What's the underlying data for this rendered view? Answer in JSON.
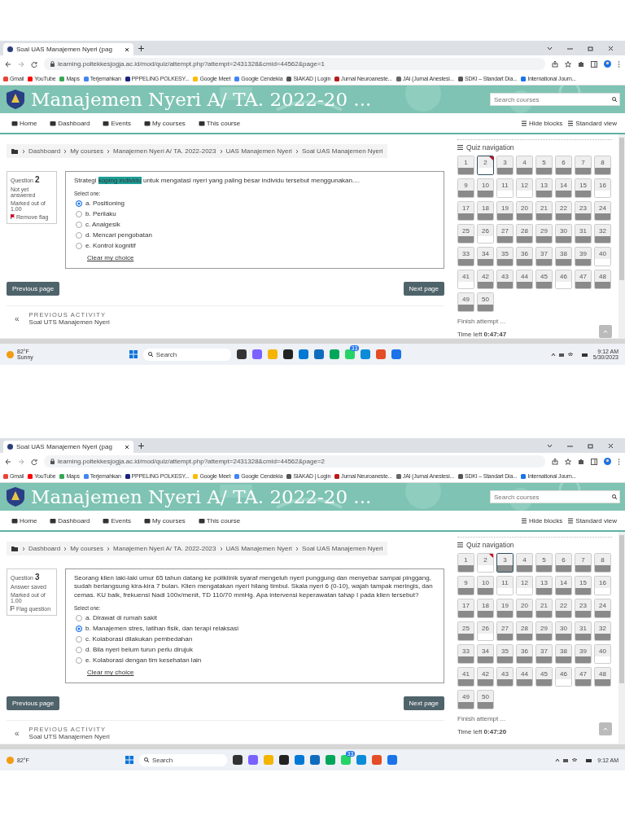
{
  "shots": [
    {
      "tab_title": "Soal UAS Manajemen Nyeri (pag",
      "url": "learning.poltekkesjogja.ac.id/mod/quiz/attempt.php?attempt=2431328&cmid=44562&page=1",
      "bookmarks": [
        "Gmail",
        "YouTube",
        "Maps",
        "Terjemahkan",
        "PPPELING POLKESY...",
        "Google Meet",
        "Google Cendekia",
        "SIAKAD | Login",
        "Jurnal Neuroaneste...",
        "JAI (Jurnal Anestesi...",
        "SDKI – Standart Dia...",
        "International Journ..."
      ],
      "site_title": "Manajemen Nyeri A/ TA. 2022-20 ...",
      "search_placeholder": "Search courses",
      "nav": [
        "Home",
        "Dashboard",
        "Events",
        "My courses",
        "This course"
      ],
      "nav_right": [
        "Hide blocks",
        "Standard view"
      ],
      "breadcrumb": [
        "Dashboard",
        "My courses",
        "Manajemen Nyeri A/ TA. 2022-2023",
        "UAS Manajemen Nyeri",
        "Soal UAS Manajemen Nyeri"
      ],
      "question": {
        "label": "Question",
        "number": "2",
        "status": "Not yet answered",
        "marks": "Marked out of 1.00",
        "flag_action": "Remove flag",
        "flagged": true,
        "text": [
          {
            "text": "Strategi ",
            "highlighted": false
          },
          {
            "text": "koping individu",
            "highlighted": true
          },
          {
            "text": " untuk mengatasi nyeri yang paling besar individu tersebut menggunakan....",
            "highlighted": false
          }
        ],
        "prompt": "Select one:",
        "options": [
          {
            "label": "a. Positioning",
            "selected": true
          },
          {
            "label": "b. Perilaku",
            "selected": false
          },
          {
            "label": "c. Analgesik",
            "selected": false
          },
          {
            "label": "d. Mencari pengobatan",
            "selected": false
          },
          {
            "label": "e. Kontrol kognitif",
            "selected": false
          }
        ],
        "clear": "Clear my choice"
      },
      "buttons": [
        "Previous page",
        "Next page"
      ],
      "previous_activity": {
        "heading": "PREVIOUS ACTIVITY",
        "title": "Soal UTS Manajemen Nyeri",
        "icon": "«"
      },
      "quiz_nav": {
        "title": "Quiz navigation",
        "items": [
          {
            "label": "1",
            "answered": true,
            "current": false,
            "flagged": false
          },
          {
            "label": "2",
            "answered": false,
            "current": true,
            "flagged": true
          },
          {
            "label": "3",
            "answered": true,
            "current": false,
            "flagged": false
          },
          {
            "label": "4",
            "answered": true,
            "current": false,
            "flagged": false
          },
          {
            "label": "5",
            "answered": true,
            "current": false,
            "flagged": false
          },
          {
            "label": "6",
            "answered": true,
            "current": false,
            "flagged": false
          },
          {
            "label": "7",
            "answered": true,
            "current": false,
            "flagged": false
          },
          {
            "label": "8",
            "answered": true,
            "current": false,
            "flagged": false
          },
          {
            "label": "9",
            "answered": true,
            "current": false,
            "flagged": false
          },
          {
            "label": "10",
            "answered": true,
            "current": false,
            "flagged": false
          },
          {
            "label": "11",
            "answered": false,
            "current": false,
            "flagged": false
          },
          {
            "label": "12",
            "answered": false,
            "current": false,
            "flagged": false
          },
          {
            "label": "13",
            "answered": true,
            "current": false,
            "flagged": false
          },
          {
            "label": "14",
            "answered": true,
            "current": false,
            "flagged": false
          },
          {
            "label": "15",
            "answered": true,
            "current": false,
            "flagged": false
          },
          {
            "label": "16",
            "answered": false,
            "current": false,
            "flagged": false
          },
          {
            "label": "17",
            "answered": true,
            "current": false,
            "flagged": false
          },
          {
            "label": "18",
            "answered": true,
            "current": false,
            "flagged": false
          },
          {
            "label": "19",
            "answered": true,
            "current": false,
            "flagged": false
          },
          {
            "label": "20",
            "answered": true,
            "current": false,
            "flagged": false
          },
          {
            "label": "21",
            "answered": true,
            "current": false,
            "flagged": false
          },
          {
            "label": "22",
            "answered": true,
            "current": false,
            "flagged": false
          },
          {
            "label": "23",
            "answered": true,
            "current": false,
            "flagged": false
          },
          {
            "label": "24",
            "answered": true,
            "current": false,
            "flagged": false
          },
          {
            "label": "25",
            "answered": true,
            "current": false,
            "flagged": false
          },
          {
            "label": "26",
            "answered": false,
            "current": false,
            "flagged": false
          },
          {
            "label": "27",
            "answered": true,
            "current": false,
            "flagged": false
          },
          {
            "label": "28",
            "answered": true,
            "current": false,
            "flagged": false
          },
          {
            "label": "29",
            "answered": true,
            "current": false,
            "flagged": false
          },
          {
            "label": "30",
            "answered": true,
            "current": false,
            "flagged": false
          },
          {
            "label": "31",
            "answered": true,
            "current": false,
            "flagged": false
          },
          {
            "label": "32",
            "answered": true,
            "current": false,
            "flagged": false
          },
          {
            "label": "33",
            "answered": true,
            "current": false,
            "flagged": false
          },
          {
            "label": "34",
            "answered": true,
            "current": false,
            "flagged": false
          },
          {
            "label": "35",
            "answered": true,
            "current": false,
            "flagged": false
          },
          {
            "label": "36",
            "answered": true,
            "current": false,
            "flagged": false
          },
          {
            "label": "37",
            "answered": true,
            "current": false,
            "flagged": false
          },
          {
            "label": "38",
            "answered": true,
            "current": false,
            "flagged": false
          },
          {
            "label": "39",
            "answered": true,
            "current": false,
            "flagged": false
          },
          {
            "label": "40",
            "answered": false,
            "current": false,
            "flagged": false
          },
          {
            "label": "41",
            "answered": false,
            "current": false,
            "flagged": false
          },
          {
            "label": "42",
            "answered": true,
            "current": false,
            "flagged": false
          },
          {
            "label": "43",
            "answered": true,
            "current": false,
            "flagged": false
          },
          {
            "label": "44",
            "answered": true,
            "current": false,
            "flagged": false
          },
          {
            "label": "45",
            "answered": true,
            "current": false,
            "flagged": false
          },
          {
            "label": "46",
            "answered": false,
            "current": false,
            "flagged": false
          },
          {
            "label": "47",
            "answered": true,
            "current": false,
            "flagged": false
          },
          {
            "label": "48",
            "answered": true,
            "current": false,
            "flagged": false
          },
          {
            "label": "49",
            "answered": true,
            "current": false,
            "flagged": false
          },
          {
            "label": "50",
            "answered": true,
            "current": false,
            "flagged": false
          }
        ],
        "finish": "Finish attempt ...",
        "time_left": "Time left **0:47:47**"
      },
      "taskbar": {
        "temperature": "82°F",
        "weather": "Sunny",
        "search": "Search",
        "badge": "33",
        "time": "9:12 AM",
        "date": "5/30/2023"
      }
    },
    {
      "tab_title": "Soal UAS Manajemen Nyeri (pag",
      "url": "learning.poltekkesjogja.ac.id/mod/quiz/attempt.php?attempt=2431328&cmid=44562&page=2",
      "bookmarks": [
        "Gmail",
        "YouTube",
        "Maps",
        "Terjemahkan",
        "PPPELING POLKESY...",
        "Google Meet",
        "Google Cendekia",
        "SIAKAD | Login",
        "Jurnal Neuroaneste...",
        "JAI (Jurnal Anestesi...",
        "SDKI – Standart Dia...",
        "International Journ..."
      ],
      "site_title": "Manajemen Nyeri A/ TA. 2022-20 ...",
      "search_placeholder": "Search courses",
      "nav": [
        "Home",
        "Dashboard",
        "Events",
        "My courses",
        "This course"
      ],
      "nav_right": [
        "Hide blocks",
        "Standard view"
      ],
      "breadcrumb": [
        "Dashboard",
        "My courses",
        "Manajemen Nyeri A/ TA. 2022-2023",
        "UAS Manajemen Nyeri",
        "Soal UAS Manajemen Nyeri"
      ],
      "question": {
        "label": "Question",
        "number": "3",
        "status": "Answer saved",
        "marks": "Marked out of 1.00",
        "flag_action": "Flag question",
        "flagged": false,
        "text": [
          {
            "text": "Seorang klien laki-laki umur 65 tahun datang ke poliklinik syaraf mengeluh nyeri punggung dan menyebar sampai pinggang, sudah berlangsung kira-kira 7 bulan. Klien mengatakan nyeri hilang timbul. Skala nyeri 6 (0-10), wajah tampak meringis, dan cemas. KU baik, frekuensi Nadi 100x/menit, TD 110/70 mmHg. Apa intervensi keperawatan tahap I pada klien tersebut?",
            "highlighted": false
          }
        ],
        "prompt": "Select one:",
        "options": [
          {
            "label": "a. Dirawat di rumah sakit",
            "selected": false
          },
          {
            "label": "b. Manajemen stres, latihan fisik, dan terapi relaksasi",
            "selected": true
          },
          {
            "label": "c. Kolaborasi dilakukan pembedahan",
            "selected": false
          },
          {
            "label": "d. Bila nyeri belum turun perlu dirujuk",
            "selected": false
          },
          {
            "label": "e. Kolaborasi dengan tim kesehatan lain",
            "selected": false
          }
        ],
        "clear": "Clear my choice"
      },
      "buttons": [
        "Previous page",
        "Next page"
      ],
      "previous_activity": {
        "heading": "PREVIOUS ACTIVITY",
        "title": "Soal UTS Manajemen Nyeri",
        "icon": "«"
      },
      "quiz_nav": {
        "title": "Quiz navigation",
        "items": [
          {
            "label": "1",
            "answered": true,
            "current": false,
            "flagged": false
          },
          {
            "label": "2",
            "answered": false,
            "current": false,
            "flagged": true
          },
          {
            "label": "3",
            "answered": true,
            "current": true,
            "flagged": false
          },
          {
            "label": "4",
            "answered": true,
            "current": false,
            "flagged": false
          },
          {
            "label": "5",
            "answered": true,
            "current": false,
            "flagged": false
          },
          {
            "label": "6",
            "answered": true,
            "current": false,
            "flagged": false
          },
          {
            "label": "7",
            "answered": true,
            "current": false,
            "flagged": false
          },
          {
            "label": "8",
            "answered": true,
            "current": false,
            "flagged": false
          },
          {
            "label": "9",
            "answered": true,
            "current": false,
            "flagged": false
          },
          {
            "label": "10",
            "answered": true,
            "current": false,
            "flagged": false
          },
          {
            "label": "11",
            "answered": false,
            "current": false,
            "flagged": false
          },
          {
            "label": "12",
            "answered": false,
            "current": false,
            "flagged": false
          },
          {
            "label": "13",
            "answered": true,
            "current": false,
            "flagged": false
          },
          {
            "label": "14",
            "answered": true,
            "current": false,
            "flagged": false
          },
          {
            "label": "15",
            "answered": true,
            "current": false,
            "flagged": false
          },
          {
            "label": "16",
            "answered": false,
            "current": false,
            "flagged": false
          },
          {
            "label": "17",
            "answered": true,
            "current": false,
            "flagged": false
          },
          {
            "label": "18",
            "answered": true,
            "current": false,
            "flagged": false
          },
          {
            "label": "19",
            "answered": true,
            "current": false,
            "flagged": false
          },
          {
            "label": "20",
            "answered": true,
            "current": false,
            "flagged": false
          },
          {
            "label": "21",
            "answered": true,
            "current": false,
            "flagged": false
          },
          {
            "label": "22",
            "answered": true,
            "current": false,
            "flagged": false
          },
          {
            "label": "23",
            "answered": true,
            "current": false,
            "flagged": false
          },
          {
            "label": "24",
            "answered": true,
            "current": false,
            "flagged": false
          },
          {
            "label": "25",
            "answered": true,
            "current": false,
            "flagged": false
          },
          {
            "label": "26",
            "answered": false,
            "current": false,
            "flagged": false
          },
          {
            "label": "27",
            "answered": true,
            "current": false,
            "flagged": false
          },
          {
            "label": "28",
            "answered": true,
            "current": false,
            "flagged": false
          },
          {
            "label": "29",
            "answered": true,
            "current": false,
            "flagged": false
          },
          {
            "label": "30",
            "answered": true,
            "current": false,
            "flagged": false
          },
          {
            "label": "31",
            "answered": true,
            "current": false,
            "flagged": false
          },
          {
            "label": "32",
            "answered": true,
            "current": false,
            "flagged": false
          },
          {
            "label": "33",
            "answered": true,
            "current": false,
            "flagged": false
          },
          {
            "label": "34",
            "answered": true,
            "current": false,
            "flagged": false
          },
          {
            "label": "35",
            "answered": true,
            "current": false,
            "flagged": false
          },
          {
            "label": "36",
            "answered": true,
            "current": false,
            "flagged": false
          },
          {
            "label": "37",
            "answered": true,
            "current": false,
            "flagged": false
          },
          {
            "label": "38",
            "answered": true,
            "current": false,
            "flagged": false
          },
          {
            "label": "39",
            "answered": true,
            "current": false,
            "flagged": false
          },
          {
            "label": "40",
            "answered": false,
            "current": false,
            "flagged": false
          },
          {
            "label": "41",
            "answered": true,
            "current": false,
            "flagged": false
          },
          {
            "label": "42",
            "answered": true,
            "current": false,
            "flagged": false
          },
          {
            "label": "43",
            "answered": true,
            "current": false,
            "flagged": false
          },
          {
            "label": "44",
            "answered": true,
            "current": false,
            "flagged": false
          },
          {
            "label": "45",
            "answered": true,
            "current": false,
            "flagged": false
          },
          {
            "label": "46",
            "answered": false,
            "current": false,
            "flagged": false
          },
          {
            "label": "47",
            "answered": true,
            "current": false,
            "flagged": false
          },
          {
            "label": "48",
            "answered": true,
            "current": false,
            "flagged": false
          },
          {
            "label": "49",
            "answered": true,
            "current": false,
            "flagged": false
          },
          {
            "label": "50",
            "answered": true,
            "current": false,
            "flagged": false
          }
        ],
        "finish": "Finish attempt ...",
        "time_left": "Time left **0:47:20**"
      },
      "taskbar": {
        "temperature": "82°F",
        "search": "Search",
        "badge": "33",
        "time": "9:12 AM"
      }
    }
  ]
}
